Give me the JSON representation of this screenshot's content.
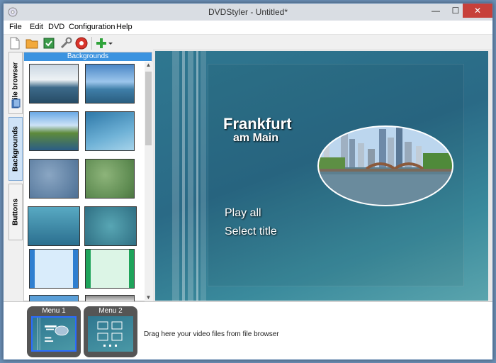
{
  "window": {
    "title": "DVDStyler - Untitled*",
    "minimize": "—",
    "maximize": "☐",
    "close": "✕"
  },
  "menubar": {
    "items": [
      "File",
      "Edit",
      "DVD",
      "Configuration",
      "Help"
    ]
  },
  "toolbar": {
    "icons": [
      "new-file-icon",
      "open-folder-icon",
      "save-burn-icon",
      "settings-wrench-icon",
      "burn-disc-icon",
      "add-plus-icon",
      "dropdown-arrow-icon"
    ]
  },
  "sidebar": {
    "tabs": [
      {
        "label": "File browser",
        "active": false
      },
      {
        "label": "Backgrounds",
        "active": true
      },
      {
        "label": "Buttons",
        "active": false
      }
    ]
  },
  "panel": {
    "header": "Backgrounds"
  },
  "canvas": {
    "title_line1": "Frankfurt",
    "title_line2": "am Main",
    "buttons": [
      "Play all",
      "Select title"
    ],
    "image": "frankfurt-skyline-oval"
  },
  "titleset": {
    "menus": [
      {
        "label": "Menu 1",
        "selected": true
      },
      {
        "label": "Menu 2",
        "selected": false
      }
    ],
    "hint": "Drag here your video files from file browser"
  },
  "colors": {
    "accent": "#3b93e0",
    "close": "#c7403a",
    "canvas_teal": "#2f7790"
  }
}
